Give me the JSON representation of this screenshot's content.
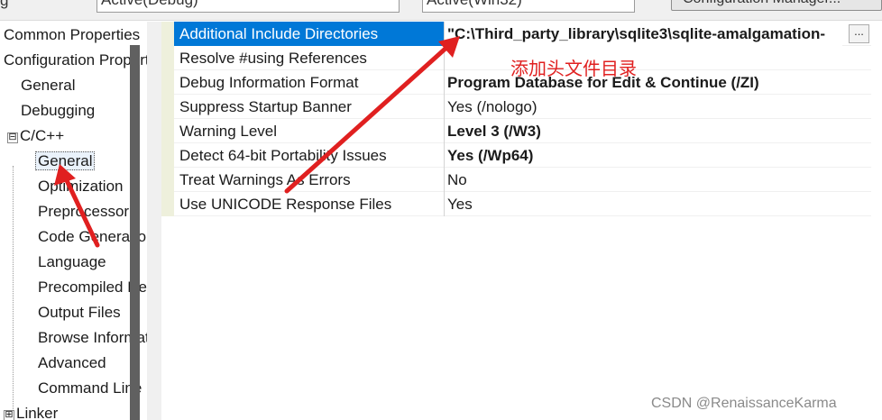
{
  "toolbar": {
    "configuration_label": "g",
    "configuration_value": "Active(Debug)",
    "platform_value": "Active(Win32)",
    "config_manager_label": "Configuration Manager..."
  },
  "tree": {
    "items": [
      {
        "label": "Common Properties"
      },
      {
        "label": "Configuration Properties"
      },
      {
        "label": "General"
      },
      {
        "label": "Debugging"
      },
      {
        "label": "C/C++",
        "expander": "⊟"
      },
      {
        "label": "General"
      },
      {
        "label": "Optimization"
      },
      {
        "label": "Preprocessor"
      },
      {
        "label": "Code Generation"
      },
      {
        "label": "Language"
      },
      {
        "label": "Precompiled Headers"
      },
      {
        "label": "Output Files"
      },
      {
        "label": "Browse Information"
      },
      {
        "label": "Advanced"
      },
      {
        "label": "Command Line"
      },
      {
        "label": "Linker",
        "expander": "⊞"
      }
    ]
  },
  "properties": [
    {
      "name": "Additional Include Directories",
      "value": "\"C:\\Third_party_library\\sqlite3\\sqlite-amalgamation-"
    },
    {
      "name": "Resolve #using References",
      "value": ""
    },
    {
      "name": "Debug Information Format",
      "value": "Program Database for Edit & Continue (/ZI)"
    },
    {
      "name": "Suppress Startup Banner",
      "value": "Yes (/nologo)"
    },
    {
      "name": "Warning Level",
      "value": "Level 3 (/W3)"
    },
    {
      "name": "Detect 64-bit Portability Issues",
      "value": "Yes (/Wp64)"
    },
    {
      "name": "Treat Warnings As Errors",
      "value": "No"
    },
    {
      "name": "Use UNICODE Response Files",
      "value": "Yes"
    }
  ],
  "edit_button_label": "...",
  "annotation": "添加头文件目录",
  "watermark": "CSDN @RenaissanceKarma",
  "colors": {
    "selection": "#0078d7",
    "arrow": "#e02020",
    "grid_margin": "#eef0dc",
    "splitter": "#606060"
  },
  "icons": [
    "expand-icon",
    "collapse-icon",
    "ellipsis-icon",
    "arrow-annotation"
  ]
}
